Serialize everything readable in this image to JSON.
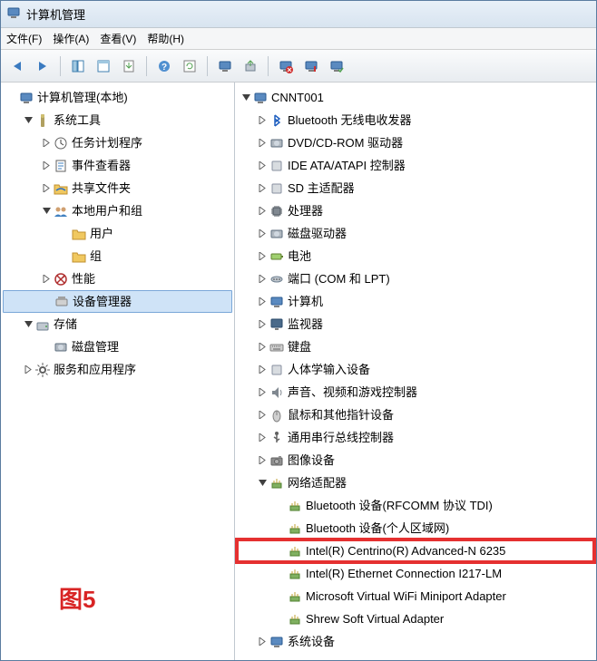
{
  "window": {
    "title": "计算机管理"
  },
  "menu": {
    "file": "文件(F)",
    "action": "操作(A)",
    "view": "查看(V)",
    "help": "帮助(H)"
  },
  "left_tree": {
    "root": {
      "label": "计算机管理(本地)"
    },
    "system_tools": {
      "label": "系统工具"
    },
    "task_scheduler": {
      "label": "任务计划程序"
    },
    "event_viewer": {
      "label": "事件查看器"
    },
    "shared_folders": {
      "label": "共享文件夹"
    },
    "local_users": {
      "label": "本地用户和组"
    },
    "users": {
      "label": "用户"
    },
    "groups": {
      "label": "组"
    },
    "performance": {
      "label": "性能"
    },
    "device_manager": {
      "label": "设备管理器"
    },
    "storage": {
      "label": "存储"
    },
    "disk_mgmt": {
      "label": "磁盘管理"
    },
    "services_apps": {
      "label": "服务和应用程序"
    }
  },
  "right_tree": {
    "root": {
      "label": "CNNT001"
    },
    "bluetooth_radio": {
      "label": "Bluetooth 无线电收发器"
    },
    "dvd_cd": {
      "label": "DVD/CD-ROM 驱动器"
    },
    "ide": {
      "label": "IDE ATA/ATAPI 控制器"
    },
    "sd": {
      "label": "SD 主适配器"
    },
    "processors": {
      "label": "处理器"
    },
    "disk_drives": {
      "label": "磁盘驱动器"
    },
    "battery": {
      "label": "电池"
    },
    "ports": {
      "label": "端口 (COM 和 LPT)"
    },
    "computers": {
      "label": "计算机"
    },
    "monitors": {
      "label": "监视器"
    },
    "keyboards": {
      "label": "键盘"
    },
    "hid": {
      "label": "人体学输入设备"
    },
    "sound": {
      "label": "声音、视频和游戏控制器"
    },
    "mice": {
      "label": "鼠标和其他指针设备"
    },
    "usb": {
      "label": "通用串行总线控制器"
    },
    "imaging": {
      "label": "图像设备"
    },
    "network_adapters": {
      "label": "网络适配器"
    },
    "net1": {
      "label": "Bluetooth 设备(RFCOMM 协议 TDI)"
    },
    "net2": {
      "label": "Bluetooth 设备(个人区域网)"
    },
    "net3": {
      "label": "Intel(R) Centrino(R) Advanced-N 6235"
    },
    "net4": {
      "label": "Intel(R) Ethernet Connection I217-LM"
    },
    "net5": {
      "label": "Microsoft Virtual WiFi Miniport Adapter"
    },
    "net6": {
      "label": "Shrew Soft Virtual Adapter"
    },
    "system_devices": {
      "label": "系统设备"
    }
  },
  "caption": "图5"
}
